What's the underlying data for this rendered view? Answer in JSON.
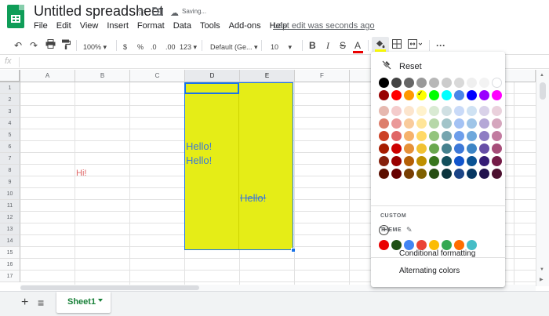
{
  "header": {
    "title": "Untitled spreadsheet",
    "saving": "Saving...",
    "last_edit": "Last edit was seconds ago",
    "menu": [
      "File",
      "Edit",
      "View",
      "Insert",
      "Format",
      "Data",
      "Tools",
      "Add-ons",
      "Help"
    ]
  },
  "toolbar": {
    "zoom": "100%",
    "currency": "$",
    "percent": "%",
    "decimal_less": ".0",
    "decimal_more": ".00",
    "more_formats": "123",
    "font": "Default (Ge...",
    "font_size": "10",
    "bold": "B",
    "italic": "I",
    "strike": "S",
    "text_color": "A",
    "more": "···"
  },
  "formula_bar": {
    "fx": "fx"
  },
  "grid": {
    "columns": [
      "A",
      "B",
      "C",
      "D",
      "E",
      "F"
    ],
    "rows": [
      "1",
      "2",
      "3",
      "4",
      "5",
      "6",
      "7",
      "8",
      "9",
      "10",
      "11",
      "12",
      "13",
      "14",
      "15",
      "16",
      "17"
    ],
    "selected_columns": [
      "D",
      "E"
    ],
    "selected_rows_from": 1,
    "selected_rows_to": 14,
    "fill_color": "#e5ed17",
    "cells": {
      "D6": "Hello!",
      "D7": "Hello!",
      "E10": "Hello!",
      "B8": "Hi!"
    }
  },
  "sheets": {
    "tabs": [
      "Sheet1"
    ],
    "active": "Sheet1"
  },
  "color_picker": {
    "reset_label": "Reset",
    "theme_label": "THEME",
    "custom_label": "CUSTOM",
    "selected_color": "#ffff00",
    "grid_colors": [
      [
        "#000000",
        "#434343",
        "#666666",
        "#999999",
        "#b7b7b7",
        "#cccccc",
        "#d9d9d9",
        "#efefef",
        "#f3f3f3",
        "#ffffff"
      ],
      [
        "#980000",
        "#ff0000",
        "#ff9900",
        "#ffff00",
        "#00ff00",
        "#00ffff",
        "#4a86e8",
        "#0000ff",
        "#9900ff",
        "#ff00ff"
      ],
      [
        "#e6b8af",
        "#f4cccc",
        "#fce5cd",
        "#fff2cc",
        "#d9ead3",
        "#d0e0e3",
        "#c9daf8",
        "#cfe2f3",
        "#d9d2e9",
        "#ead1dc"
      ],
      [
        "#dd7e6b",
        "#ea9999",
        "#f9cb9c",
        "#ffe599",
        "#b6d7a8",
        "#a2c4c9",
        "#a4c2f4",
        "#9fc5e8",
        "#b4a7d6",
        "#d5a6bd"
      ],
      [
        "#cc4125",
        "#e06666",
        "#f6b26b",
        "#ffd966",
        "#93c47d",
        "#76a5af",
        "#6d9eeb",
        "#6fa8dc",
        "#8e7cc3",
        "#c27ba0"
      ],
      [
        "#a61c00",
        "#cc0000",
        "#e69138",
        "#f1c232",
        "#6aa84f",
        "#45818e",
        "#3c78d8",
        "#3d85c6",
        "#674ea7",
        "#a64d79"
      ],
      [
        "#85200c",
        "#990000",
        "#b45f06",
        "#bf9000",
        "#38761d",
        "#134f5c",
        "#1155cc",
        "#0b5394",
        "#351c75",
        "#741b47"
      ],
      [
        "#5b0f00",
        "#660000",
        "#783f04",
        "#7f6000",
        "#274e13",
        "#0c343d",
        "#1c4587",
        "#073763",
        "#20124d",
        "#4c1130"
      ]
    ],
    "theme_colors": [
      "#ea0000",
      "#1e4f13",
      "#4285f4",
      "#ea4335",
      "#fbbc04",
      "#34a853",
      "#ff6d01",
      "#46bdc6"
    ],
    "items": [
      "Conditional formatting",
      "Alternating colors"
    ]
  }
}
